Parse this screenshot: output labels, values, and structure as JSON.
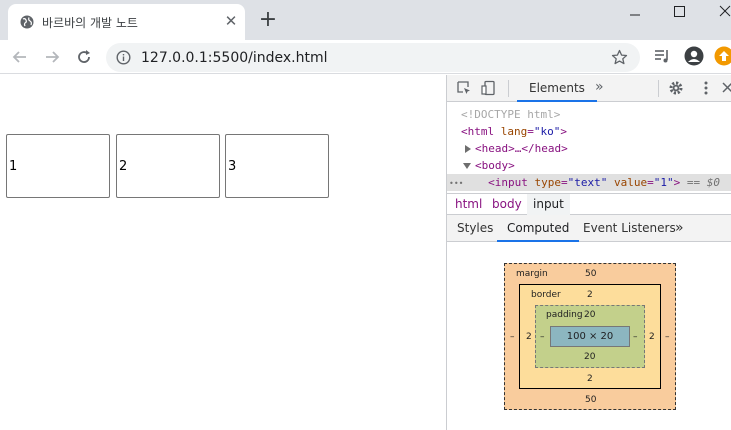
{
  "browser": {
    "tab_title": "바르바의 개발 노트",
    "tab_close": "✕",
    "new_tab": "+",
    "window_controls": {
      "minimize": "—",
      "maximize": "☐",
      "close": "✕"
    },
    "url": "127.0.0.1:5500/index.html"
  },
  "page": {
    "inputs": [
      {
        "value": "1"
      },
      {
        "value": "2"
      },
      {
        "value": "3"
      }
    ]
  },
  "devtools": {
    "main_tab": "Elements",
    "more_tabs": "»",
    "dom": {
      "doctype": "<!DOCTYPE html>",
      "html_open": "<html",
      "html_attr": "lang",
      "html_val": "\"ko\"",
      "html_close": ">",
      "head": "<head>…</head>",
      "body": "<body>",
      "ellipsis": "•••",
      "input_tag": "<input",
      "input_type_attr": "type",
      "input_type_val": "\"text\"",
      "input_value_attr": "value",
      "input_value_val": "\"1\"",
      "input_end": ">",
      "selected_marker": "== $0"
    },
    "breadcrumbs": [
      "html",
      "body",
      "input"
    ],
    "subtabs": [
      "Styles",
      "Computed",
      "Event Listeners"
    ],
    "subtabs_more": "»",
    "box_model": {
      "margin_label": "margin",
      "margin_top": "50",
      "margin_bottom": "50",
      "margin_left": "–",
      "margin_right": "–",
      "border_label": "border",
      "border_top": "2",
      "border_bottom": "2",
      "border_left": "2",
      "border_right": "2",
      "padding_label": "padding",
      "padding_top": "20",
      "padding_bottom": "20",
      "padding_left": "–",
      "padding_right": "–",
      "content": "100 × 20"
    }
  },
  "colors": {
    "margin": "#f9cc9d",
    "border": "#fddd9b",
    "padding": "#c3d08b",
    "content": "#8cb6c0",
    "accent": "#1a73e8"
  }
}
